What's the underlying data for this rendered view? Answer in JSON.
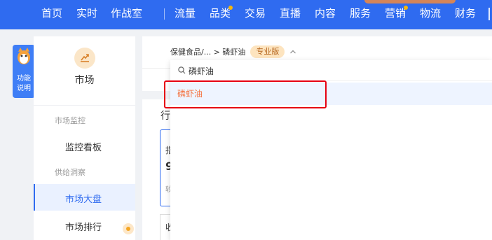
{
  "topnav": {
    "items": [
      "首页",
      "实时",
      "作战室",
      "流量",
      "品类",
      "交易",
      "直播",
      "内容",
      "服务",
      "营销",
      "物流",
      "财务"
    ]
  },
  "helptab": {
    "label_line1": "功能",
    "label_line2": "说明"
  },
  "sidebar": {
    "module_title": "市场",
    "groups": [
      "市场监控",
      "供给洞察"
    ],
    "items": [
      "监控看板",
      "市场大盘",
      "市场排行"
    ],
    "active_item": "市场大盘"
  },
  "main": {
    "fragment_1": "行",
    "fragment_2": "指",
    "fragment_3": "9",
    "fragment_4": "较",
    "fragment_5": "收"
  },
  "category_selector": {
    "breadcrumb": "保健食品/... > 磷虾油",
    "edition_badge": "专业版"
  },
  "dropdown": {
    "search_value": "磷虾油",
    "options": [
      "磷虾油"
    ]
  },
  "colors": {
    "brand": "#2f6bf0",
    "highlight_text": "#f5703d",
    "annotation": "#e60012"
  }
}
